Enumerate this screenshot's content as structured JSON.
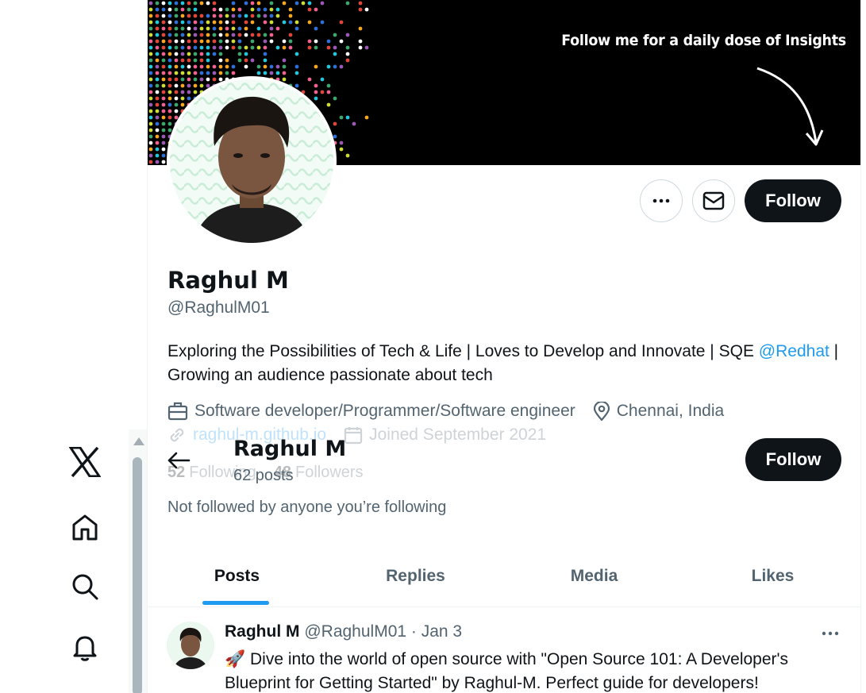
{
  "banner": {
    "text": "Follow me for a daily dose of Insights"
  },
  "profile": {
    "name": "Raghul M",
    "handle": "@RaghulM01",
    "bio_text": "Exploring the Possibilities of Tech & Life | Loves to Develop and Innovate | SQE",
    "bio_mention": "@Redhat",
    "bio_rest": " | Growing an audience passionate about tech",
    "profession": "Software developer/Programmer/Software engineer",
    "location": "Chennai, India",
    "website": "raghul-m.github.io",
    "joined": "Joined September 2021",
    "following_count": "52",
    "following_label": "Following",
    "followers_count": "48",
    "followers_label": "Followers",
    "not_followed": "Not followed by anyone you’re following"
  },
  "actions": {
    "follow_label": "Follow"
  },
  "sticky_header": {
    "name": "Raghul M",
    "posts": "62 posts",
    "follow_label": "Follow"
  },
  "tabs": [
    {
      "label": "Posts",
      "active": true
    },
    {
      "label": "Replies",
      "active": false
    },
    {
      "label": "Media",
      "active": false
    },
    {
      "label": "Likes",
      "active": false
    }
  ],
  "post": {
    "name": "Raghul M",
    "handle": "@RaghulM01",
    "date": "· Jan 3",
    "emoji": "🚀",
    "text": "Dive into the world of open source with \"Open Source 101: A Developer's Blueprint for Getting Started\" by Raghul-M. Perfect guide for developers!"
  },
  "colors": {
    "accent": "#1d9bf0",
    "text": "#0f1419",
    "secondary": "#536471",
    "button": "#0f1419"
  },
  "icons": [
    "x-logo-icon",
    "home-icon",
    "search-icon",
    "bell-icon",
    "more-icon",
    "mail-icon",
    "briefcase-icon",
    "location-icon",
    "link-icon",
    "calendar-icon",
    "back-arrow-icon"
  ]
}
